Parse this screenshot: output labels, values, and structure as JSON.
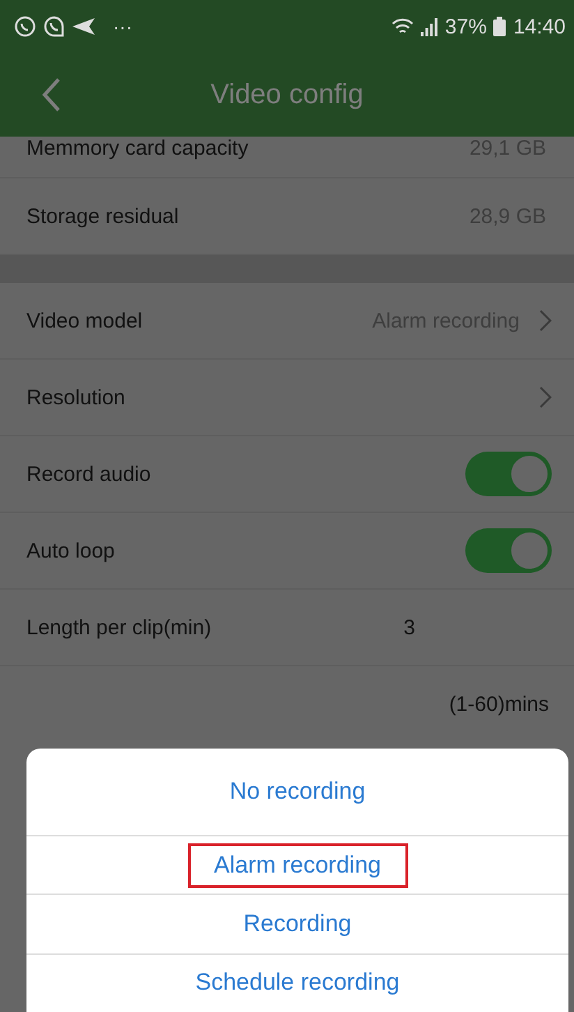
{
  "status_bar": {
    "left_more": "···",
    "battery": "37%",
    "time": "14:40"
  },
  "header": {
    "title": "Video config"
  },
  "sections": [
    {
      "rows": [
        {
          "kind": "value",
          "label": "Memmory card capacity",
          "value": "29,1 GB"
        },
        {
          "kind": "value",
          "label": "Storage residual",
          "value": "28,9 GB"
        }
      ]
    },
    {
      "rows": [
        {
          "kind": "nav",
          "label": "Video model",
          "value": "Alarm recording"
        },
        {
          "kind": "nav",
          "label": "Resolution"
        },
        {
          "kind": "toggle",
          "label": "Record audio",
          "on": true
        },
        {
          "kind": "toggle",
          "label": "Auto loop",
          "on": true
        },
        {
          "kind": "number",
          "label": "Length per clip(min)",
          "value": "3"
        },
        {
          "kind": "hint",
          "value": "(1-60)mins"
        }
      ]
    }
  ],
  "sheet": {
    "options": [
      {
        "label": "No recording",
        "highlighted": false
      },
      {
        "label": "Alarm recording",
        "highlighted": true
      },
      {
        "label": "Recording",
        "highlighted": false
      },
      {
        "label": "Schedule recording",
        "highlighted": false
      }
    ]
  }
}
